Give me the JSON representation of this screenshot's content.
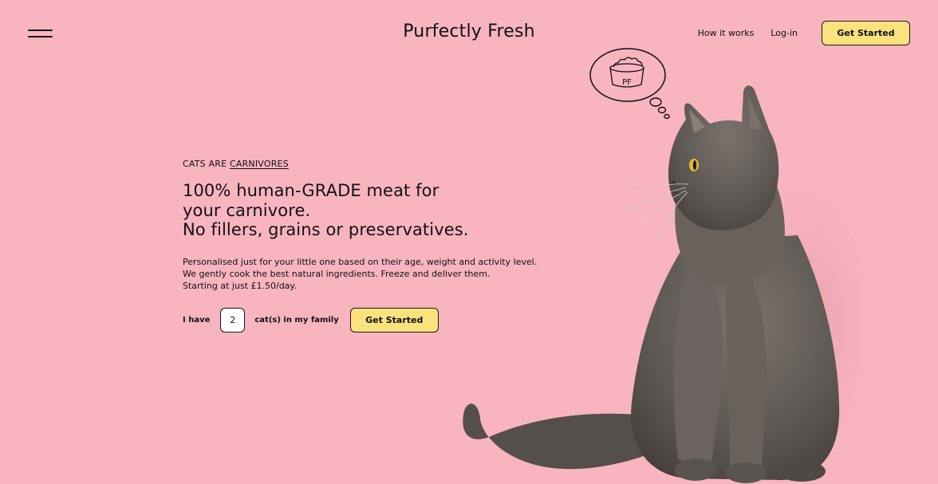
{
  "header": {
    "menu_icon": "hamburger-menu-icon",
    "brand": "Purfectly Fresh",
    "nav": {
      "how_it_works": "How it works",
      "login": "Log-in",
      "get_started": "Get Started"
    }
  },
  "hero": {
    "eyebrow_prefix": "CATS ARE",
    "eyebrow_link": "CARNIVORES",
    "headline": [
      "100% human-GRADE meat for",
      "your carnivore.",
      "No fillers, grains or preservatives."
    ],
    "description": [
      "Personalised just for your little one based on their age, weight and activity level.",
      "We gently cook the best natural ingredients. Freeze and deliver them.",
      "Starting at just £1.50/day."
    ],
    "cta": {
      "prefix": "I have",
      "cat_count": "2",
      "suffix": "cat(s) in my family",
      "button": "Get Started"
    }
  },
  "illustration": {
    "bowl_label": "PF",
    "icons": [
      "thought-bubble-icon",
      "food-bowl-icon",
      "cat-photo"
    ]
  },
  "colors": {
    "background": "#f8b4bf",
    "button": "#fbe27c",
    "text": "#111111",
    "cat": "#5d5753"
  }
}
